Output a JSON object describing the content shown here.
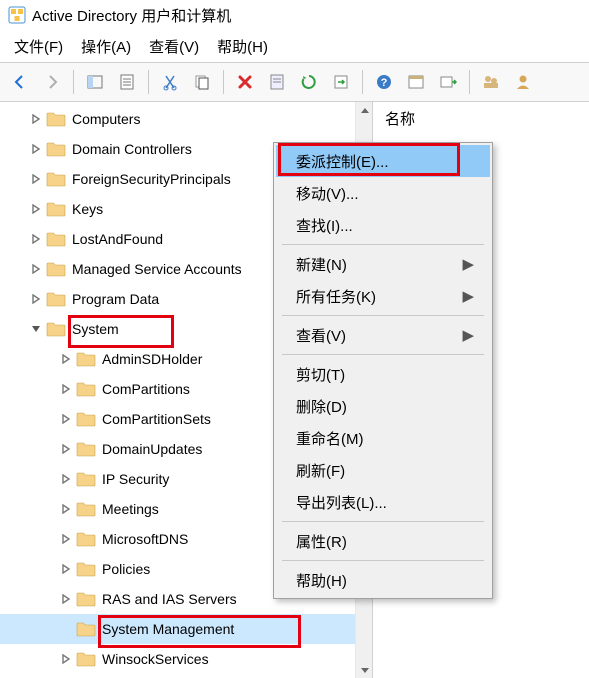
{
  "title": "Active Directory 用户和计算机",
  "menubar": {
    "file": "文件(F)",
    "action": "操作(A)",
    "view": "查看(V)",
    "help": "帮助(H)"
  },
  "tree": {
    "items": [
      {
        "label": "Computers",
        "level": 1,
        "exp": "closed"
      },
      {
        "label": "Domain Controllers",
        "level": 1,
        "exp": "closed"
      },
      {
        "label": "ForeignSecurityPrincipals",
        "level": 1,
        "exp": "closed"
      },
      {
        "label": "Keys",
        "level": 1,
        "exp": "closed"
      },
      {
        "label": "LostAndFound",
        "level": 1,
        "exp": "closed"
      },
      {
        "label": "Managed Service Accounts",
        "level": 1,
        "exp": "closed"
      },
      {
        "label": "Program Data",
        "level": 1,
        "exp": "closed"
      },
      {
        "label": "System",
        "level": 1,
        "exp": "open"
      },
      {
        "label": "AdminSDHolder",
        "level": 2,
        "exp": "closed"
      },
      {
        "label": "ComPartitions",
        "level": 2,
        "exp": "closed"
      },
      {
        "label": "ComPartitionSets",
        "level": 2,
        "exp": "closed"
      },
      {
        "label": "DomainUpdates",
        "level": 2,
        "exp": "closed"
      },
      {
        "label": "IP Security",
        "level": 2,
        "exp": "closed"
      },
      {
        "label": "Meetings",
        "level": 2,
        "exp": "closed"
      },
      {
        "label": "MicrosoftDNS",
        "level": 2,
        "exp": "closed"
      },
      {
        "label": "Policies",
        "level": 2,
        "exp": "closed"
      },
      {
        "label": "RAS and IAS Servers",
        "level": 2,
        "exp": "closed"
      },
      {
        "label": "System Management",
        "level": 2,
        "exp": "none",
        "selected": true
      },
      {
        "label": "WinsockServices",
        "level": 2,
        "exp": "closed"
      }
    ]
  },
  "right": {
    "header": "名称"
  },
  "ctx": {
    "delegate": "委派控制(E)...",
    "move": "移动(V)...",
    "find": "查找(I)...",
    "new": "新建(N)",
    "alltasks": "所有任务(K)",
    "view": "查看(V)",
    "cut": "剪切(T)",
    "delete": "删除(D)",
    "rename": "重命名(M)",
    "refresh": "刷新(F)",
    "export": "导出列表(L)...",
    "props": "属性(R)",
    "help": "帮助(H)"
  }
}
